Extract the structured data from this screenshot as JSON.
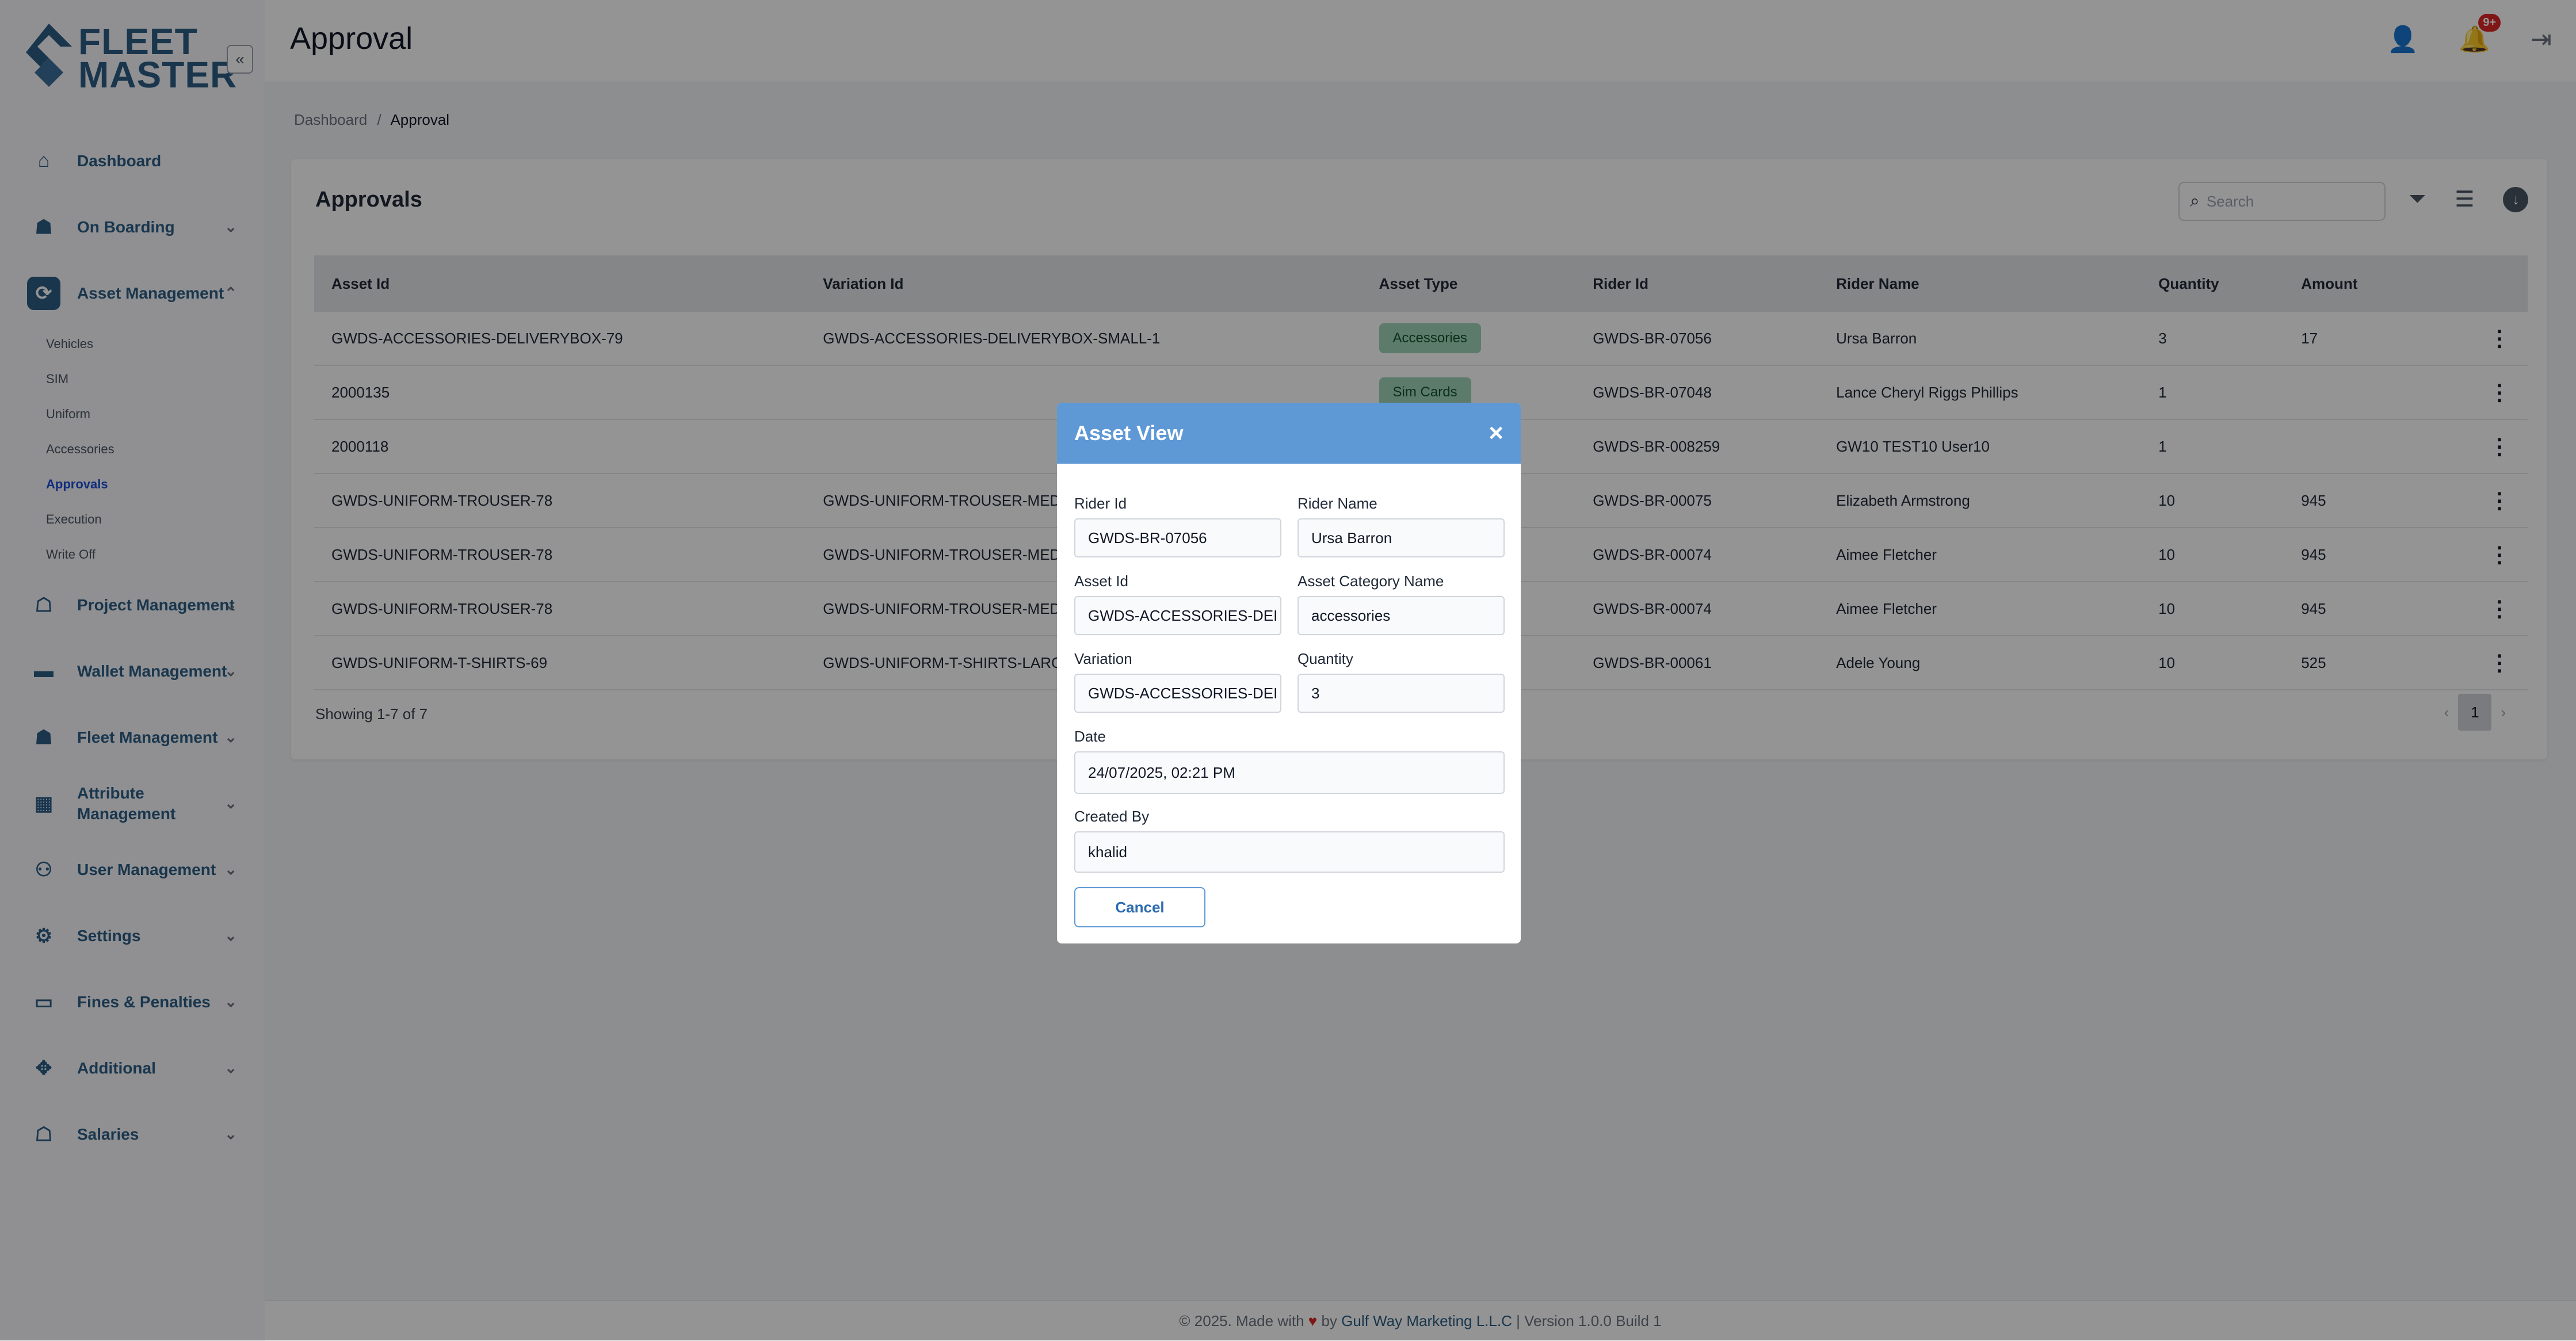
{
  "app": {
    "logo_line1": "FLEET",
    "logo_line2": "MASTER",
    "page_title": "Approval"
  },
  "colors": {
    "brand": "#2c5d86",
    "modal_header": "#5e99d6",
    "badge": "#dc2626",
    "chip_accessories": "#9fd5b9",
    "chip_simcards": "#9fd5b9"
  },
  "sidebar": {
    "items": [
      {
        "label": "Dashboard",
        "icon": "home-icon"
      },
      {
        "label": "On Boarding",
        "icon": "onboarding-icon"
      },
      {
        "label": "Asset Management",
        "icon": "asset-icon"
      },
      {
        "label": "Project Management",
        "icon": "project-icon"
      },
      {
        "label": "Wallet Management",
        "icon": "wallet-icon"
      },
      {
        "label": "Fleet Management",
        "icon": "fleet-icon"
      },
      {
        "label": "Attribute",
        "label2": "Management",
        "icon": "attribute-icon"
      },
      {
        "label": "User Management",
        "icon": "users-icon"
      },
      {
        "label": "Settings",
        "icon": "gear-icon"
      },
      {
        "label": "Fines & Penalties",
        "icon": "fines-icon"
      },
      {
        "label": "Additional",
        "icon": "additional-icon"
      },
      {
        "label": "Salaries",
        "icon": "salaries-icon"
      }
    ],
    "asset_sub": [
      "Vehicles",
      "SIM",
      "Uniform",
      "Accessories",
      "Approvals",
      "Execution",
      "Write Off"
    ]
  },
  "header": {
    "notif_count": "9+"
  },
  "breadcrumb": {
    "home": "Dashboard",
    "sep": "/",
    "current": "Approval"
  },
  "card": {
    "title": "Approvals",
    "search_placeholder": "Search",
    "showing": "Showing 1-7 of 7",
    "page": "1"
  },
  "table": {
    "headers": [
      "Asset Id",
      "Variation Id",
      "Asset Type",
      "Rider Id",
      "Rider Name",
      "Quantity",
      "Amount"
    ],
    "rows": [
      {
        "asset_id": "GWDS-ACCESSORIES-DELIVERYBOX-79",
        "variation_id": "GWDS-ACCESSORIES-DELIVERYBOX-SMALL-1",
        "asset_type": "Accessories",
        "rider_id": "GWDS-BR-07056",
        "rider_name": "Ursa Barron",
        "quantity": "3",
        "amount": "17"
      },
      {
        "asset_id": "2000135",
        "variation_id": "",
        "asset_type": "Sim Cards",
        "rider_id": "GWDS-BR-07048",
        "rider_name": "Lance Cheryl Riggs Phillips",
        "quantity": "1",
        "amount": ""
      },
      {
        "asset_id": "2000118",
        "variation_id": "",
        "asset_type": "",
        "rider_id": "GWDS-BR-008259",
        "rider_name": "GW10 TEST10 User10",
        "quantity": "1",
        "amount": ""
      },
      {
        "asset_id": "GWDS-UNIFORM-TROUSER-78",
        "variation_id": "GWDS-UNIFORM-TROUSER-MED",
        "asset_type": "",
        "rider_id": "GWDS-BR-00075",
        "rider_name": "Elizabeth Armstrong",
        "quantity": "10",
        "amount": "945"
      },
      {
        "asset_id": "GWDS-UNIFORM-TROUSER-78",
        "variation_id": "GWDS-UNIFORM-TROUSER-MED",
        "asset_type": "",
        "rider_id": "GWDS-BR-00074",
        "rider_name": "Aimee Fletcher",
        "quantity": "10",
        "amount": "945"
      },
      {
        "asset_id": "GWDS-UNIFORM-TROUSER-78",
        "variation_id": "GWDS-UNIFORM-TROUSER-MED",
        "asset_type": "",
        "rider_id": "GWDS-BR-00074",
        "rider_name": "Aimee Fletcher",
        "quantity": "10",
        "amount": "945"
      },
      {
        "asset_id": "GWDS-UNIFORM-T-SHIRTS-69",
        "variation_id": "GWDS-UNIFORM-T-SHIRTS-LARG",
        "asset_type": "",
        "rider_id": "GWDS-BR-00061",
        "rider_name": "Adele Young",
        "quantity": "10",
        "amount": "525"
      }
    ]
  },
  "modal": {
    "title": "Asset View",
    "rider_id_label": "Rider Id",
    "rider_id": "GWDS-BR-07056",
    "rider_name_label": "Rider Name",
    "rider_name": "Ursa Barron",
    "asset_id_label": "Asset Id",
    "asset_id": "GWDS-ACCESSORIES-DEI",
    "asset_category_label": "Asset Category Name",
    "asset_category": "accessories",
    "variation_label": "Variation",
    "variation": "GWDS-ACCESSORIES-DEI",
    "quantity_label": "Quantity",
    "quantity": "3",
    "date_label": "Date",
    "date": "24/07/2025, 02:21 PM",
    "created_by_label": "Created By",
    "created_by": "khalid",
    "cancel": "Cancel"
  },
  "footer": {
    "prefix": "© 2025. Made with",
    "by": "by",
    "company": "Gulf Way Marketing L.L.C",
    "version": "| Version 1.0.0 Build 1"
  }
}
